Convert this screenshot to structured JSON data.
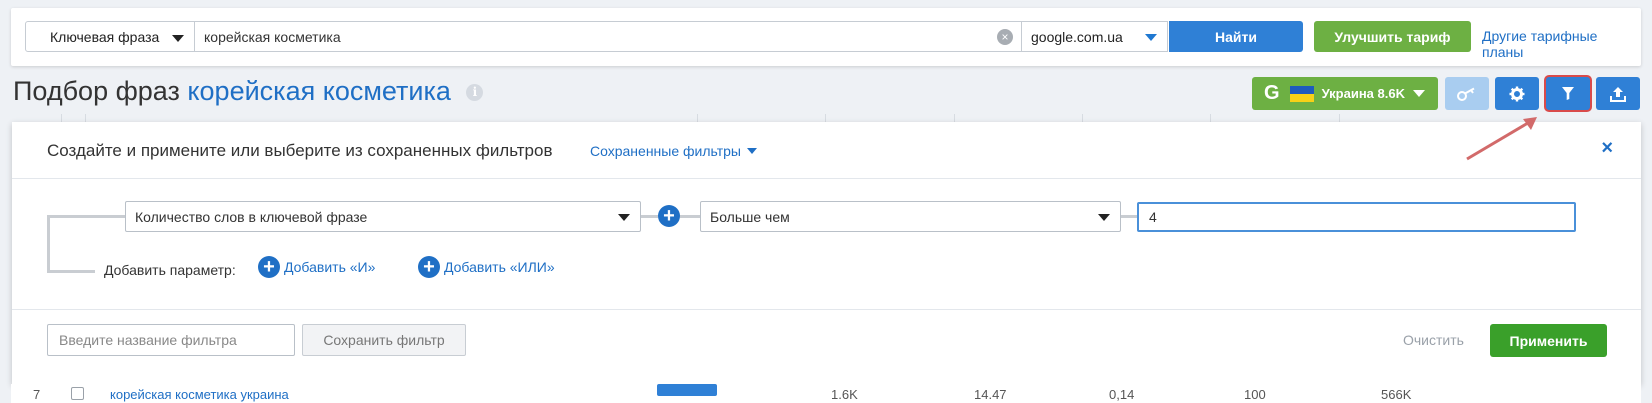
{
  "search": {
    "type_label": "Ключевая фраза",
    "query": "корейская косметика",
    "domain": "google.com.ua",
    "find_label": "Найти",
    "upgrade_label": "Улучшить тариф",
    "plans_link": "Другие тарифные планы"
  },
  "header": {
    "title_prefix": "Подбор фраз",
    "title_keyword": "корейская косметика",
    "info_glyph": "i",
    "google_glyph": "G",
    "region_label": "Украина 8.6K"
  },
  "filter_panel": {
    "title": "Создайте и примените или выберите из сохраненных фильтров",
    "saved_filters_label": "Сохраненные фильтры",
    "close_glyph": "×",
    "param_value": "Количество слов в ключевой фразе",
    "condition_value": "Больше чем",
    "value_input": "4",
    "add_param_label": "Добавить параметр:",
    "add_and_label": "Добавить «И»",
    "add_or_label": "Добавить «ИЛИ»",
    "plus_glyph": "+",
    "name_placeholder": "Введите название фильтра",
    "save_label": "Сохранить фильтр",
    "clear_label": "Очистить",
    "apply_label": "Применить"
  },
  "table_row": {
    "num": "7",
    "phrase": "корейская косметика украина",
    "volume": "1.6K",
    "cpc": "14.47",
    "competition": "0,14",
    "results_a": "100",
    "results_b": "566K"
  },
  "colors": {
    "primary": "#2f80d6",
    "green": "#6db043",
    "apply_green": "#3aa02a",
    "link": "#1f6fc5",
    "highlight": "#d94b4b"
  },
  "icons": [
    "clear-icon",
    "info-icon",
    "google-icon",
    "ukraine-flag-icon",
    "key-icon",
    "gear-icon",
    "filter-icon",
    "upload-icon",
    "close-icon",
    "plus-circle-icon",
    "chevron-down-icon"
  ]
}
